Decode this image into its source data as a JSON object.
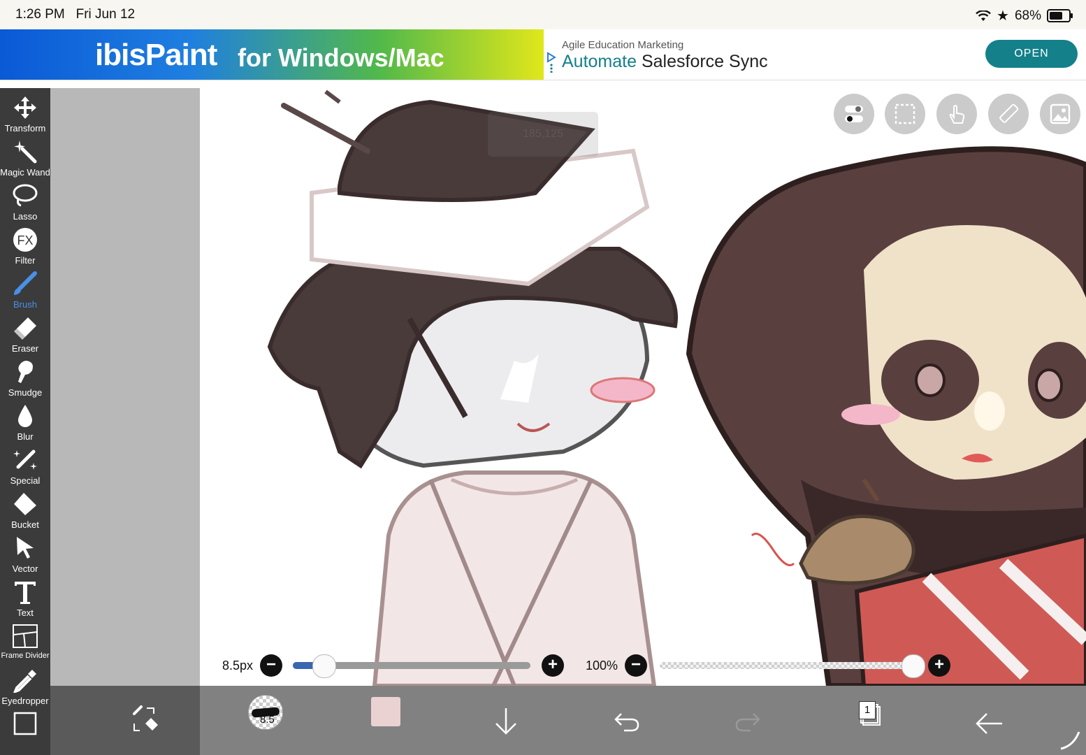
{
  "status_bar": {
    "time": "1:26 PM",
    "date": "Fri Jun 12",
    "battery": "68%"
  },
  "ad": {
    "brand": "ibisPaint",
    "tagline": "for Windows/Mac",
    "company": "Agile Education Marketing",
    "headline_accent": "Automate",
    "headline_rest": "Salesforce Sync",
    "open_label": "OPEN",
    "accent_color": "#13808a"
  },
  "toolbar": {
    "tools": [
      {
        "label": "Transform",
        "icon": "move-icon"
      },
      {
        "label": "Magic Wand",
        "icon": "magic-wand-icon"
      },
      {
        "label": "Lasso",
        "icon": "lasso-icon"
      },
      {
        "label": "Filter",
        "icon": "fx-icon"
      },
      {
        "label": "Brush",
        "icon": "brush-icon",
        "active": true
      },
      {
        "label": "Eraser",
        "icon": "eraser-icon"
      },
      {
        "label": "Smudge",
        "icon": "smudge-icon"
      },
      {
        "label": "Blur",
        "icon": "blur-drop-icon"
      },
      {
        "label": "Special",
        "icon": "special-pen-icon"
      },
      {
        "label": "Bucket",
        "icon": "bucket-icon"
      },
      {
        "label": "Vector",
        "icon": "vector-cursor-icon"
      },
      {
        "label": "Text",
        "icon": "text-icon"
      },
      {
        "label": "Frame Divider",
        "icon": "frame-divider-icon"
      },
      {
        "label": "Eyedropper",
        "icon": "eyedropper-icon"
      }
    ],
    "active_color": "#4a8fe8"
  },
  "canvas": {
    "hint_text": "185,125"
  },
  "brush_size": {
    "label": "8.5px",
    "value": 8.5,
    "fraction": 0.13
  },
  "brush_opacity": {
    "label": "100%",
    "value": 100
  },
  "bottom_bar": {
    "brush_size_badge": "8.5",
    "current_color": "#ead2d3",
    "layer_count": "1"
  }
}
